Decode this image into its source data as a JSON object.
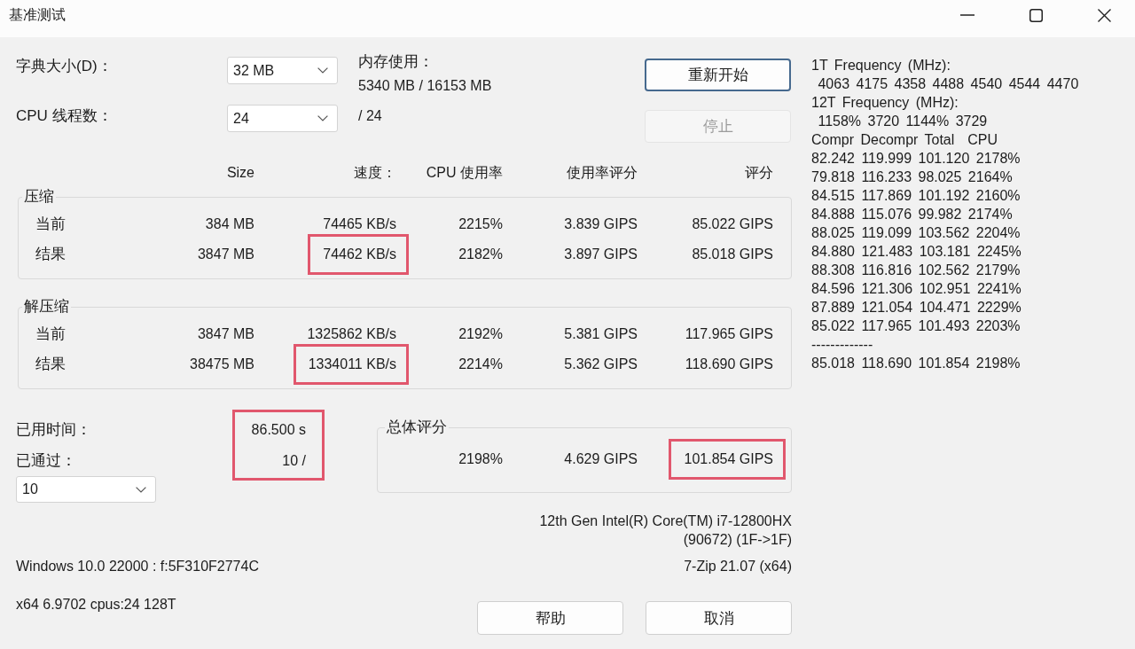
{
  "window": {
    "title": "基准测试"
  },
  "dictionary": {
    "label": "字典大小(D)：",
    "value": "32 MB"
  },
  "memory": {
    "label": "内存使用：",
    "value": "5340 MB / 16153 MB"
  },
  "threads": {
    "label": "CPU 线程数：",
    "value": "24",
    "total": "/ 24"
  },
  "top_buttons": [
    {
      "label": "重新开始",
      "default": true,
      "disabled": false
    },
    {
      "label": "停止",
      "default": false,
      "disabled": true
    }
  ],
  "columns": [
    "Size",
    "速度：",
    "CPU 使用率",
    "使用率评分",
    "评分"
  ],
  "groups": [
    {
      "title": "压缩",
      "rows": [
        {
          "label": "当前",
          "cells": [
            {
              "text": "384 MB",
              "highlighted": false
            },
            {
              "text": "74465 KB/s",
              "highlighted": false
            },
            {
              "text": "2215%",
              "highlighted": false
            },
            {
              "text": "3.839 GIPS",
              "highlighted": false
            },
            {
              "text": "85.022 GIPS",
              "highlighted": false
            }
          ]
        },
        {
          "label": "结果",
          "cells": [
            {
              "text": "3847 MB",
              "highlighted": false
            },
            {
              "text": "74462 KB/s",
              "highlighted": true
            },
            {
              "text": "2182%",
              "highlighted": false
            },
            {
              "text": "3.897 GIPS",
              "highlighted": false
            },
            {
              "text": "85.018 GIPS",
              "highlighted": false
            }
          ]
        }
      ]
    },
    {
      "title": "解压缩",
      "rows": [
        {
          "label": "当前",
          "cells": [
            {
              "text": "3847 MB",
              "highlighted": false
            },
            {
              "text": "1325862 KB/s",
              "highlighted": false
            },
            {
              "text": "2192%",
              "highlighted": false
            },
            {
              "text": "5.381 GIPS",
              "highlighted": false
            },
            {
              "text": "117.965 GIPS",
              "highlighted": false
            }
          ]
        },
        {
          "label": "结果",
          "cells": [
            {
              "text": "38475 MB",
              "highlighted": false
            },
            {
              "text": "1334011 KB/s",
              "highlighted": true
            },
            {
              "text": "2214%",
              "highlighted": false
            },
            {
              "text": "5.362 GIPS",
              "highlighted": false
            },
            {
              "text": "118.690 GIPS",
              "highlighted": false
            }
          ]
        }
      ]
    }
  ],
  "progress": {
    "elapsed_label": "已用时间：",
    "elapsed": "86.500 s",
    "passed_label": "已通过：",
    "passed": "10 /",
    "highlighted": true,
    "passes_value": "10"
  },
  "total": {
    "title": "总体评分",
    "cells": [
      {
        "text": "2198%",
        "highlighted": false
      },
      {
        "text": "4.629 GIPS",
        "highlighted": false
      },
      {
        "text": "101.854 GIPS",
        "highlighted": true
      }
    ]
  },
  "cpu_name": [
    "12th Gen Intel(R) Core(TM) i7-12800HX",
    "(90672) (1F->1F)"
  ],
  "os_info": "Windows 10.0 22000 : f:5F310F2774C",
  "version": "7-Zip 21.07 (x64)",
  "system": "x64 6.9702 cpus:24 128T",
  "bottom_buttons": [
    "帮助",
    "取消"
  ],
  "log": [
    "1T Frequency (MHz):",
    " 4063 4175 4358 4488 4540 4544 4470",
    "12T Frequency (MHz):",
    " 1158% 3720 1144% 3729",
    "Compr Decompr Total  CPU",
    "82.242 119.999 101.120 2178%",
    "79.818 116.233 98.025 2164%",
    "84.515 117.869 101.192 2160%",
    "84.888 115.076 99.982 2174%",
    "88.025 119.099 103.562 2204%",
    "84.880 121.483 103.181 2245%",
    "88.308 116.816 102.562 2179%",
    "84.596 121.306 102.951 2241%",
    "87.889 121.054 104.471 2229%",
    "85.022 117.965 101.493 2203%",
    "-------------",
    "85.018 118.690 101.854 2198%"
  ]
}
